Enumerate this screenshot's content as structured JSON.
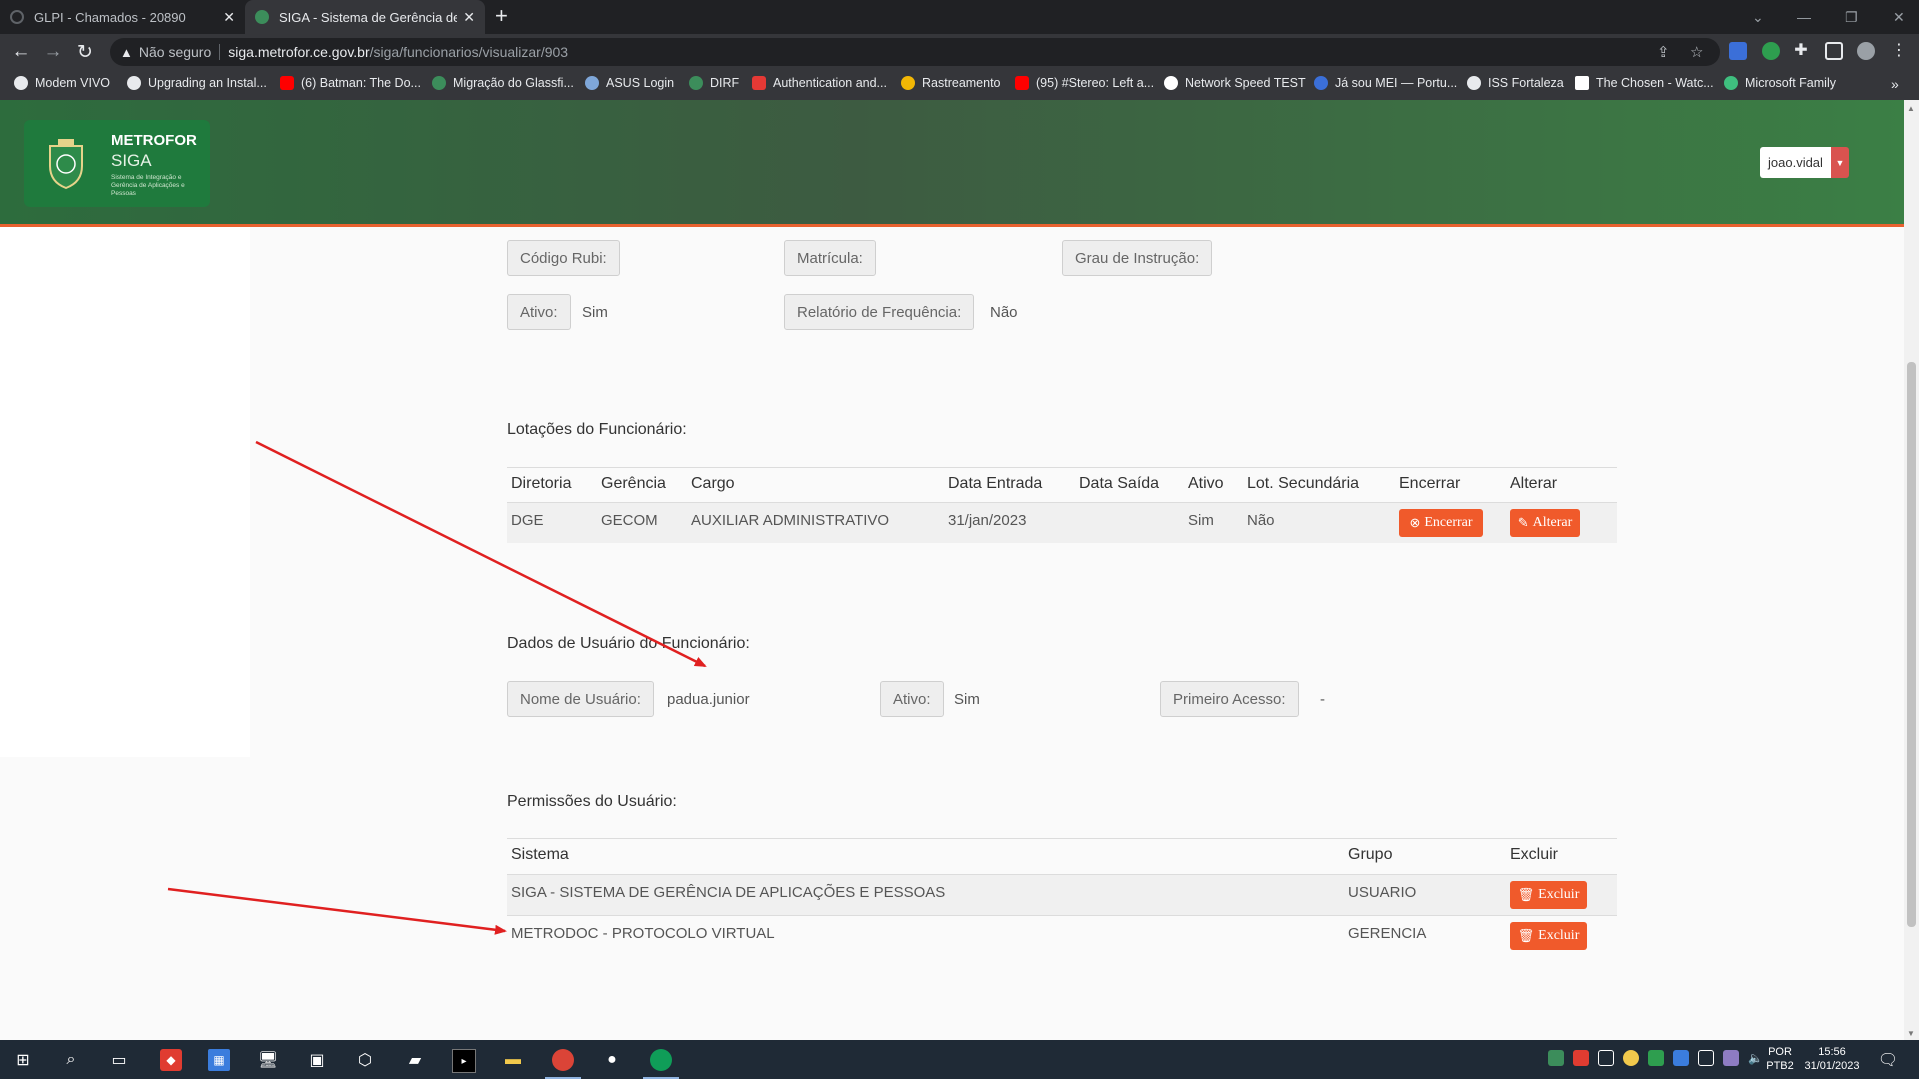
{
  "browser": {
    "tabs": [
      {
        "title": "GLPI - Chamados - 20890"
      },
      {
        "title": "SIGA - Sistema de Gerência de Aç..."
      }
    ],
    "new_tab": "+",
    "address": {
      "security_label": "Não seguro",
      "host": "siga.metrofor.ce.gov.br",
      "path": "/siga/funcionarios/visualizar/903"
    },
    "bookmarks": [
      {
        "label": "Modem VIVO",
        "color": "#e8eaed"
      },
      {
        "label": "Upgrading an Instal...",
        "color": "#e8eaed"
      },
      {
        "label": "(6) Batman: The Do...",
        "color": "#ff0000"
      },
      {
        "label": "Migração do Glassfi...",
        "color": "#3c8d5b"
      },
      {
        "label": "ASUS Login",
        "color": "#7fa7d9"
      },
      {
        "label": "DIRF",
        "color": "#3c8d5b"
      },
      {
        "label": "Authentication and...",
        "color": "#e53935"
      },
      {
        "label": "Rastreamento",
        "color": "#f2b705"
      },
      {
        "label": "(95) #Stereo: Left a...",
        "color": "#ff0000"
      },
      {
        "label": "Network Speed TEST",
        "color": "#ffffff"
      },
      {
        "label": "Já sou MEI — Portu...",
        "color": "#3b6fd8"
      },
      {
        "label": "ISS Fortaleza",
        "color": "#e8eaed"
      },
      {
        "label": "The Chosen - Watc...",
        "color": "#ffffff"
      },
      {
        "label": "Microsoft Family",
        "color": "#3fbf7f"
      }
    ],
    "bookmarks_overflow": "»"
  },
  "header": {
    "logo_title": "METROFOR",
    "logo_subtitle": "SIGA",
    "logo_tagline": "Sistema de Integração e Gerência de Aplicações e Pessoas",
    "user": "joao.vidal"
  },
  "employee_info": {
    "codigo_rubi_label": "Código Rubi:",
    "codigo_rubi_value": "",
    "matricula_label": "Matrícula:",
    "matricula_value": "",
    "grau_label": "Grau de Instrução:",
    "grau_value": "",
    "ativo_label": "Ativo:",
    "ativo_value": "Sim",
    "relatorio_label": "Relatório de Frequência:",
    "relatorio_value": "Não"
  },
  "lotacoes": {
    "title": "Lotações do Funcionário:",
    "headers": [
      "Diretoria",
      "Gerência",
      "Cargo",
      "Data Entrada",
      "Data Saída",
      "Ativo",
      "Lot. Secundária",
      "Encerrar",
      "Alterar"
    ],
    "rows": [
      {
        "diretoria": "DGE",
        "gerencia": "GECOM",
        "cargo": "AUXILIAR ADMINISTRATIVO",
        "entrada": "31/jan/2023",
        "saida": "",
        "ativo": "Sim",
        "secundaria": "Não",
        "encerrar": "Encerrar",
        "alterar": "Alterar"
      }
    ]
  },
  "usuario": {
    "title": "Dados de Usuário do Funcionário:",
    "nome_label": "Nome de Usuário:",
    "nome_value": "padua.junior",
    "ativo_label": "Ativo:",
    "ativo_value": "Sim",
    "primeiro_label": "Primeiro Acesso:",
    "primeiro_value": "-"
  },
  "permissoes": {
    "title": "Permissões do Usuário:",
    "headers": [
      "Sistema",
      "Grupo",
      "Excluir"
    ],
    "rows": [
      {
        "sistema": "SIGA - SISTEMA DE GERÊNCIA DE APLICAÇÕES E PESSOAS",
        "grupo": "USUARIO",
        "excluir": "Excluir"
      },
      {
        "sistema": "METRODOC - PROTOCOLO VIRTUAL",
        "grupo": "GERENCIA",
        "excluir": "Excluir"
      }
    ]
  },
  "annotations": {
    "arrow_color": "#e02020"
  },
  "taskbar": {
    "lang1": "POR",
    "lang2": "PTB2",
    "time": "15:56",
    "date": "31/01/2023"
  }
}
